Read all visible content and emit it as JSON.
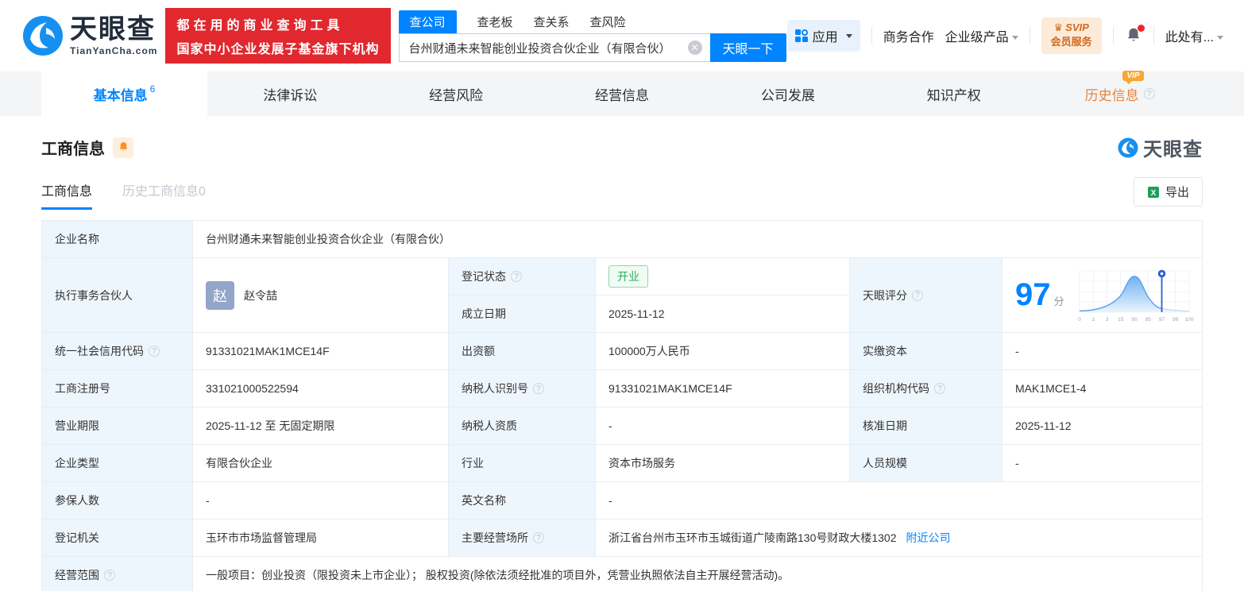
{
  "brand": {
    "name": "天眼查",
    "domain": "TianYanCha.com",
    "banner_line1": "都在用的商业查询工具",
    "banner_line2": "国家中小企业发展子基金旗下机构"
  },
  "search": {
    "tabs": [
      "查公司",
      "查老板",
      "查关系",
      "查风险"
    ],
    "value": "台州财通未来智能创业投资合伙企业（有限合伙）",
    "button": "天眼一下"
  },
  "nav": {
    "apps": "应用",
    "coop": "商务合作",
    "enterprise": "企业级产品",
    "svip_line1": "SVIP",
    "svip_line2": "会员服务",
    "user": "此处有..."
  },
  "tabs": {
    "t0": "基本信息",
    "t0_count": "6",
    "t1": "法律诉讼",
    "t2": "经营风险",
    "t3": "经营信息",
    "t4": "公司发展",
    "t5": "知识产权",
    "t6": "历史信息",
    "t6_tag": "VIP"
  },
  "section": {
    "title": "工商信息",
    "watermark": "天眼查",
    "subtab_active": "工商信息",
    "subtab_history": "历史工商信息0",
    "export": "导出"
  },
  "table": {
    "r1": {
      "label": "企业名称",
      "value": "台州财通未来智能创业投资合伙企业（有限合伙）"
    },
    "r2": {
      "label": "执行事务合伙人",
      "avatar": "赵",
      "name": "赵令喆",
      "status_label": "登记状态",
      "status": "开业",
      "date_label": "成立日期",
      "date": "2025-11-12",
      "score_label": "天眼评分"
    },
    "rows": [
      {
        "l1": "统一社会信用代码",
        "v1": "91331021MAK1MCE14F",
        "l2": "出资额",
        "v2": "100000万人民币",
        "l3": "实缴资本",
        "v3": "-"
      },
      {
        "l1": "工商注册号",
        "v1": "331021000522594",
        "l2": "纳税人识别号",
        "v2": "91331021MAK1MCE14F",
        "l3": "组织机构代码",
        "v3": "MAK1MCE1-4"
      },
      {
        "l1": "营业期限",
        "v1": "2025-11-12 至 无固定期限",
        "l2": "纳税人资质",
        "v2": "-",
        "l3": "核准日期",
        "v3": "2025-11-12"
      },
      {
        "l1": "企业类型",
        "v1": "有限合伙企业",
        "l2": "行业",
        "v2": "资本市场服务",
        "l3": "人员规模",
        "v3": "-"
      }
    ],
    "r7": {
      "l1": "参保人数",
      "v1": "-",
      "l2": "英文名称",
      "v2": "-"
    },
    "r8": {
      "l1": "登记机关",
      "v1": "玉环市市场监督管理局",
      "l2": "主要经营场所",
      "v2": "浙江省台州市玉环市玉城街道广陵南路130号财政大楼1302",
      "link": "附近公司"
    },
    "r9": {
      "label": "经营范围",
      "value": "一般项目：创业投资（限投资未上市企业）； 股权投资(除依法须经批准的项目外，凭营业执照依法自主开展经营活动)。"
    }
  },
  "score": {
    "value": "97",
    "unit": "分",
    "chart_data": {
      "type": "area",
      "ticks": [
        "0",
        "1",
        "3",
        "15",
        "50",
        "85",
        "97",
        "99",
        "100"
      ],
      "marker_at": "97"
    }
  },
  "colors": {
    "primary": "#0084ff",
    "banner_red": "#e0282e",
    "open_green": "#2bb05c",
    "vip_orange": "#f7a733"
  }
}
